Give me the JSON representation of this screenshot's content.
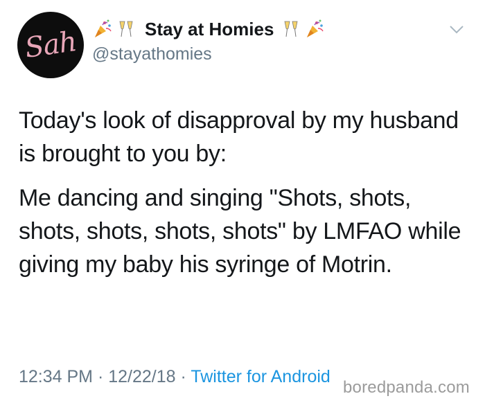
{
  "tweet": {
    "avatar_text": "Sah",
    "display_name": "Stay at Homies",
    "handle": "@stayathomies",
    "name_emoji": [
      "party-popper-icon",
      "champagne-glasses-icon",
      "champagne-glasses-icon",
      "party-popper-icon"
    ],
    "body": [
      "Today's look of disapproval by my husband is brought to you by:",
      "Me dancing and singing \"Shots, shots, shots, shots, shots, shots\" by LMFAO while giving my baby his syringe of Motrin."
    ],
    "time": "12:34 PM",
    "separator": " · ",
    "date": "12/22/18",
    "source": "Twitter for Android"
  },
  "watermark": "boredpanda.com",
  "colors": {
    "text": "#14171a",
    "muted": "#657786",
    "link": "#1b95e0",
    "avatar_bg": "#0d0d0d",
    "avatar_text": "#e8a6b8"
  }
}
